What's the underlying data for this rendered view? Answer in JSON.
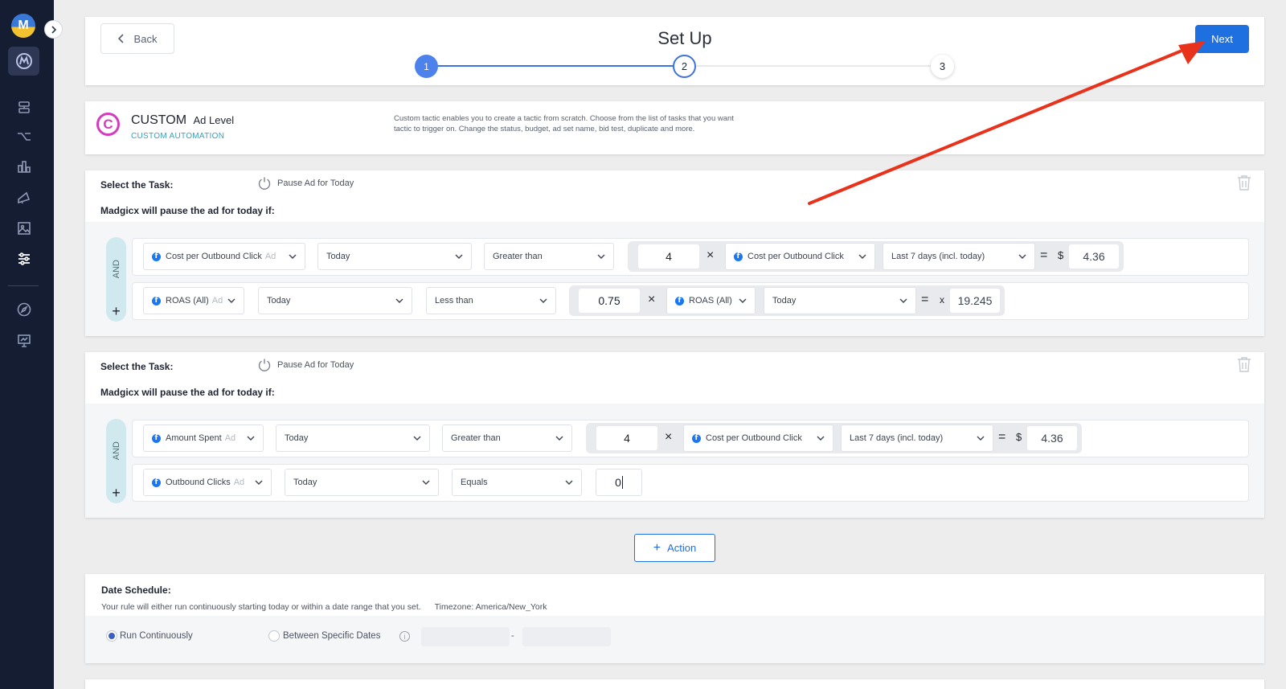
{
  "header": {
    "back_label": "Back",
    "title": "Set Up",
    "steps": [
      "1",
      "2",
      "3"
    ],
    "next_label": "Next"
  },
  "tactic": {
    "badge": "C",
    "name": "CUSTOM",
    "level": "Ad Level",
    "type": "CUSTOM AUTOMATION",
    "description": "Custom tactic enables you to create a tactic from scratch. Choose from the list of tasks that you want tactic to trigger on. Change the status, budget, ad set name, bid test, duplicate and more."
  },
  "tasks": [
    {
      "select_label": "Select the Task:",
      "task_name": "Pause Ad for Today",
      "condition_text": "Madgicx will pause the ad for today if:",
      "and_label": "AND",
      "rows": [
        {
          "metric": "Cost per Outbound Click",
          "metric_level": "Ad",
          "period": "Today",
          "operator": "Greater than",
          "multiplier": "4",
          "times": "×",
          "compare_metric": "Cost per Outbound Click",
          "compare_period": "Last 7 days (incl. today)",
          "equals": "=",
          "unit": "$",
          "result": "4.36"
        },
        {
          "metric": "ROAS (All)",
          "metric_level": "Ad",
          "period": "Today",
          "operator": "Less than",
          "multiplier": "0.75",
          "times": "×",
          "compare_metric": "ROAS (All)",
          "compare_period": "Today",
          "equals": "=",
          "unit": "x",
          "result": "19.245"
        }
      ]
    },
    {
      "select_label": "Select the Task:",
      "task_name": "Pause Ad for Today",
      "condition_text": "Madgicx will pause the ad for today if:",
      "and_label": "AND",
      "rows": [
        {
          "metric": "Amount Spent",
          "metric_level": "Ad",
          "period": "Today",
          "operator": "Greater than",
          "multiplier": "4",
          "times": "×",
          "compare_metric": "Cost per Outbound Click",
          "compare_period": "Last 7 days (incl. today)",
          "equals": "=",
          "unit": "$",
          "result": "4.36"
        },
        {
          "metric": "Outbound Clicks",
          "metric_level": "Ad",
          "period": "Today",
          "operator": "Equals",
          "value": "0"
        }
      ]
    }
  ],
  "action_label": "Action",
  "schedule": {
    "title": "Date Schedule:",
    "description": "Your rule will either run continuously starting today or within a date range that you set.",
    "timezone": "Timezone: America/New_York",
    "option_continuous": "Run Continuously",
    "option_dates": "Between Specific Dates",
    "date_separator": "-"
  },
  "colors": {
    "sidebar": "#151d33",
    "primary": "#1e6fe0",
    "arrow": "#e8321c",
    "custom_badge": "#d43cbf"
  }
}
